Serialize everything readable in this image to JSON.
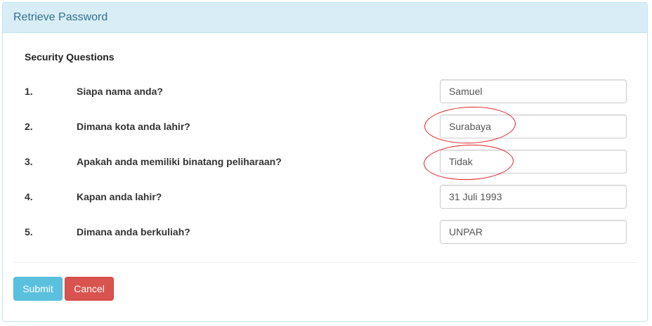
{
  "panel": {
    "title": "Retrieve Password"
  },
  "form": {
    "section_title": "Security Questions",
    "questions": [
      {
        "number": "1.",
        "text": "Siapa nama anda?",
        "value": "Samuel"
      },
      {
        "number": "2.",
        "text": "Dimana kota anda lahir?",
        "value": "Surabaya"
      },
      {
        "number": "3.",
        "text": "Apakah anda memiliki binatang peliharaan?",
        "value": "Tidak"
      },
      {
        "number": "4.",
        "text": "Kapan anda lahir?",
        "value": "31 Juli 1993"
      },
      {
        "number": "5.",
        "text": "Dimana anda berkuliah?",
        "value": "UNPAR"
      }
    ]
  },
  "actions": {
    "submit_label": "Submit",
    "cancel_label": "Cancel"
  },
  "colors": {
    "heading_bg": "#d9edf7",
    "heading_text": "#31708f",
    "submit": "#5bc0de",
    "cancel": "#d9534f",
    "annotation": "#e02020"
  }
}
